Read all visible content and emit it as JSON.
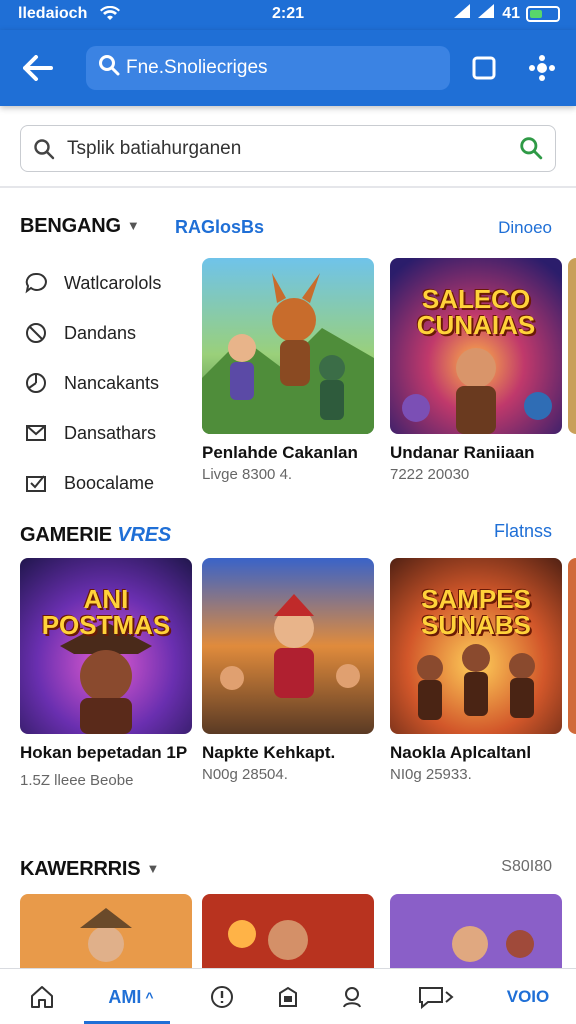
{
  "status_bar": {
    "carrier": "lledaioch",
    "time": "2:21",
    "signal": "41"
  },
  "appbar": {
    "search_text": "Fne.Snoliecriges"
  },
  "search": {
    "value": "Tsplik batiahurganen"
  },
  "section1": {
    "title": "BENGANG",
    "tab": "RAGlosBs",
    "more": "Dinoeo",
    "side_items": [
      {
        "label": "Watlcarolols",
        "icon": "speech-bubble-icon"
      },
      {
        "label": "Dandans",
        "icon": "block-icon"
      },
      {
        "label": "Nancakants",
        "icon": "pie-clock-icon"
      },
      {
        "label": "Dansathars",
        "icon": "mail-icon"
      },
      {
        "label": "Boocalame",
        "icon": "checkbox-icon"
      }
    ],
    "cards": [
      {
        "title": "Penlahde Cakanlan",
        "subtitle": "Livge 8300 4.",
        "art_text": ""
      },
      {
        "title": "Undanar Raniiaan",
        "subtitle": "7222 20030",
        "art_text": "SALECO CUNAIAS"
      }
    ]
  },
  "section2": {
    "title": "GAMERIE",
    "title_accent": "VRES",
    "more": "Flatnss",
    "cards": [
      {
        "title": "Hokan bepetadan 1P",
        "subtitle": "1.5Z lleee Beobe",
        "art_text": "ANI POSTMAS"
      },
      {
        "title": "Napkte Kehkapt.",
        "subtitle": "N00g 28504.",
        "art_text": ""
      },
      {
        "title": "Naokla Aplcaltanl",
        "subtitle": "NI0g 25933.",
        "art_text": "SAMPES SUNABS"
      }
    ]
  },
  "section3": {
    "title": "KAWERRRIS",
    "more": "S80I80"
  },
  "tabbar": {
    "active_label": "AMI",
    "right_label": "VOIO"
  },
  "colors": {
    "brand_blue": "#1f6fd6",
    "search_fill": "#3b83e3",
    "go_green": "#2f9a46"
  }
}
